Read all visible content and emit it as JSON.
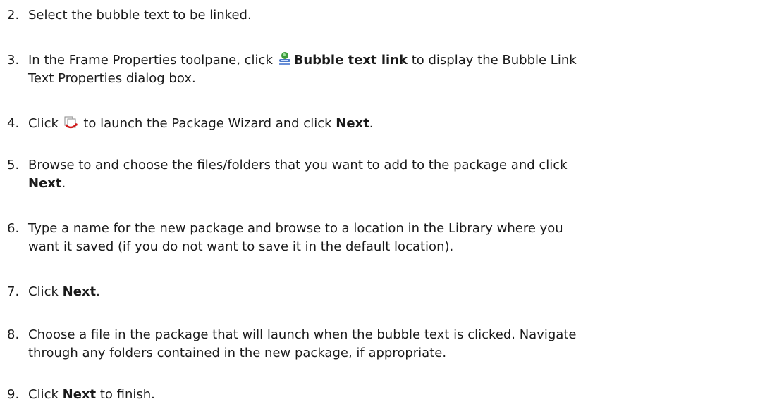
{
  "steps": [
    {
      "number": "2.",
      "text": "Select the bubble text to be linked."
    },
    {
      "number": "3.",
      "text_before": "In the Frame Properties toolpane, click ",
      "icon": "bubble-text-link-icon",
      "bold": "Bubble text link",
      "text_after": " to display the Bubble Link",
      "line2": "Text Properties dialog box."
    },
    {
      "number": "4.",
      "text_before": "Click ",
      "icon": "package-wizard-icon",
      "text_middle": " to launch the Package Wizard and click ",
      "bold": "Next",
      "text_after": "."
    },
    {
      "number": "5.",
      "line1": "Browse to and choose the files/folders that you want to add to the package and click",
      "bold": "Next",
      "text_after": "."
    },
    {
      "number": "6.",
      "line1": "Type a name for the new package and browse to a location in the Library where you",
      "line2": "want it saved (if you do not want to save it in the default location)."
    },
    {
      "number": "7.",
      "text_before": "Click ",
      "bold": "Next",
      "text_after": "."
    },
    {
      "number": "8.",
      "line1": "Choose a file in the package that will launch when the bubble text is clicked. Navigate",
      "line2": "through any folders contained in the new package, if appropriate."
    },
    {
      "number": "9.",
      "text_before": "Click ",
      "bold": "Next",
      "text_after": " to finish."
    }
  ]
}
